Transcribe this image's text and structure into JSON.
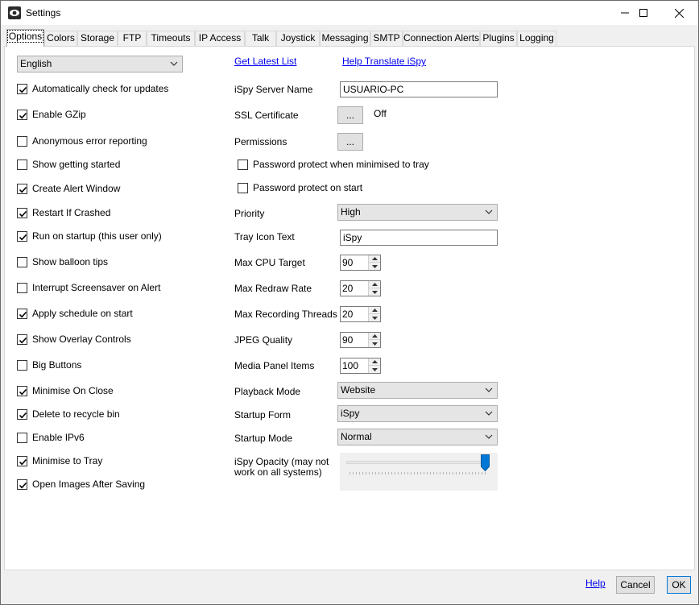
{
  "window": {
    "title": "Settings"
  },
  "tabs": [
    "Options",
    "Colors",
    "Storage",
    "FTP",
    "Timeouts",
    "IP Access",
    "Talk",
    "Joystick",
    "Messaging",
    "SMTP",
    "Connection Alerts",
    "Plugins",
    "Logging"
  ],
  "language": {
    "value": "English"
  },
  "checkboxes": [
    {
      "label": "Automatically check for updates",
      "checked": true
    },
    {
      "label": "Enable GZip",
      "checked": true
    },
    {
      "label": "Anonymous error reporting",
      "checked": false
    },
    {
      "label": "Show getting started",
      "checked": false
    },
    {
      "label": "Create Alert Window",
      "checked": true
    },
    {
      "label": "Restart If Crashed",
      "checked": true
    },
    {
      "label": "Run on startup (this user only)",
      "checked": true
    },
    {
      "label": "Show balloon tips",
      "checked": false
    },
    {
      "label": "Interrupt Screensaver on Alert",
      "checked": false
    },
    {
      "label": "Apply schedule on start",
      "checked": true
    },
    {
      "label": "Show Overlay Controls",
      "checked": true
    },
    {
      "label": "Big Buttons",
      "checked": false
    },
    {
      "label": "Minimise On Close",
      "checked": true
    },
    {
      "label": "Delete to recycle bin",
      "checked": true
    },
    {
      "label": "Enable IPv6",
      "checked": false
    },
    {
      "label": "Minimise to Tray",
      "checked": true
    },
    {
      "label": "Open Images After Saving",
      "checked": true
    }
  ],
  "links": {
    "get_latest": "Get Latest List",
    "help_translate": "Help Translate iSpy"
  },
  "server": {
    "label": "iSpy Server Name",
    "value": "USUARIO-PC"
  },
  "ssl": {
    "label": "SSL Certificate",
    "button": "...",
    "status": "Off"
  },
  "permissions": {
    "label": "Permissions",
    "button": "..."
  },
  "password": {
    "tray": {
      "label": "Password protect when minimised to tray",
      "checked": false
    },
    "start": {
      "label": "Password protect on start",
      "checked": false
    }
  },
  "priority": {
    "label": "Priority",
    "value": "High"
  },
  "tray_icon": {
    "label": "Tray Icon Text",
    "value": "iSpy"
  },
  "spinners": {
    "cpu": {
      "label": "Max CPU Target",
      "value": "90"
    },
    "redraw": {
      "label": "Max Redraw Rate",
      "value": "20"
    },
    "recording": {
      "label": "Max Recording Threads",
      "value": "20"
    },
    "jpeg": {
      "label": "JPEG Quality",
      "value": "90"
    },
    "media": {
      "label": "Media Panel Items",
      "value": "100"
    }
  },
  "playback": {
    "label": "Playback Mode",
    "value": "Website"
  },
  "startup_form": {
    "label": "Startup Form",
    "value": "iSpy"
  },
  "startup_mode": {
    "label": "Startup Mode",
    "value": "Normal"
  },
  "opacity": {
    "label_line1": "iSpy Opacity (may not",
    "label_line2": "work on all systems)",
    "level": 1.0
  },
  "footer": {
    "help": "Help",
    "cancel": "Cancel",
    "ok": "OK"
  }
}
